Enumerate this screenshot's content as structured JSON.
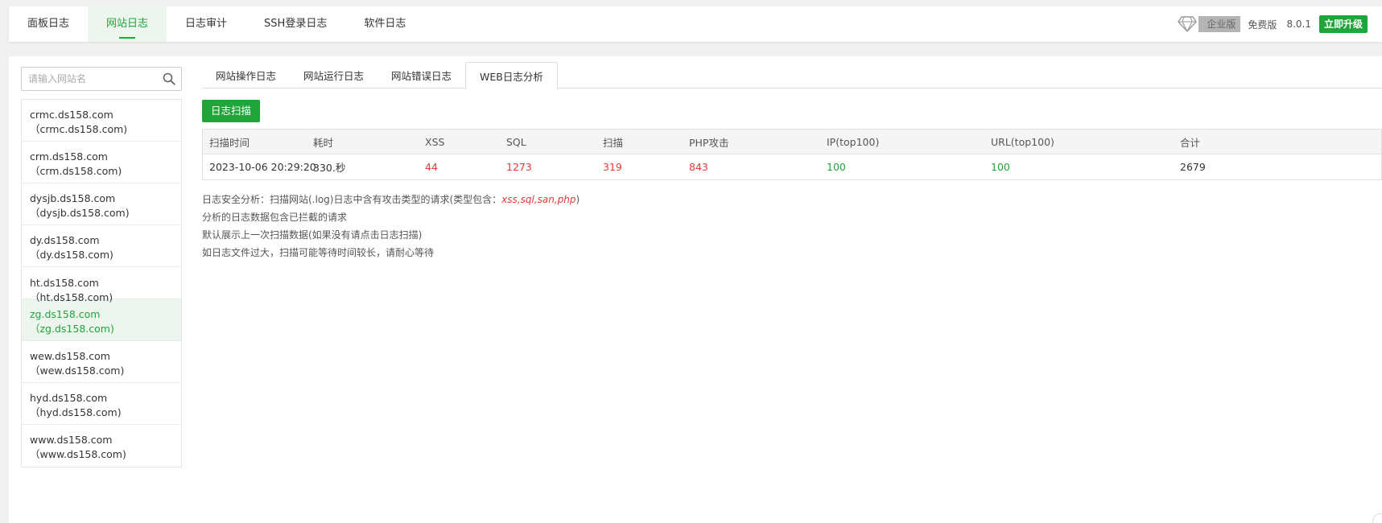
{
  "topbar": {
    "tabs": [
      "面板日志",
      "网站日志",
      "日志审计",
      "SSH登录日志",
      "软件日志"
    ],
    "active_tab": 1,
    "edition_badge": "企业版",
    "free_label": "免费版",
    "version": "8.0.1",
    "upgrade_label": "立即升级"
  },
  "sidebar": {
    "search_placeholder": "请输入网站名",
    "sites": [
      {
        "name": "crmc.ds158.com",
        "sub": "（crmc.ds158.com)"
      },
      {
        "name": "crm.ds158.com",
        "sub": "（crm.ds158.com)"
      },
      {
        "name": "dysjb.ds158.com",
        "sub": "（dysjb.ds158.com)"
      },
      {
        "name": "dy.ds158.com",
        "sub": "（dy.ds158.com)"
      },
      {
        "name": "ht.ds158.com（ht.ds158.com)",
        "sub": ""
      },
      {
        "name": "zg.ds158.com",
        "sub": "（zg.ds158.com)"
      },
      {
        "name": "wew.ds158.com",
        "sub": "（wew.ds158.com)"
      },
      {
        "name": "hyd.ds158.com",
        "sub": "（hyd.ds158.com)"
      },
      {
        "name": "www.ds158.com",
        "sub": "（www.ds158.com)"
      }
    ],
    "active_index": 5
  },
  "subtabs": [
    "网站操作日志",
    "网站运行日志",
    "网站错误日志",
    "WEB日志分析"
  ],
  "active_subtab": 3,
  "scan_button": "日志扫描",
  "table": {
    "headers": [
      "扫描时间",
      "耗时",
      "XSS",
      "SQL",
      "扫描",
      "PHP攻击",
      "IP(top100)",
      "URL(top100)",
      "合计"
    ],
    "row": [
      "2023-10-06 20:29:20",
      "330.秒",
      "44",
      "1273",
      "319",
      "843",
      "100",
      "100",
      "2679"
    ]
  },
  "notes": {
    "line1_prefix": "日志安全分析：扫描网站(.log)日志中含有攻击类型的请求(类型包含：",
    "line1_types": "xss,sql,san,php",
    "line1_suffix": ")",
    "line2": "分析的日志数据包含已拦截的请求",
    "line3": "默认展示上一次扫描数据(如果没有请点击日志扫描)",
    "line4": "如日志文件过大，扫描可能等待时间较长，请耐心等待"
  },
  "colors": {
    "accent": "#20a53a",
    "danger": "#e53935"
  }
}
